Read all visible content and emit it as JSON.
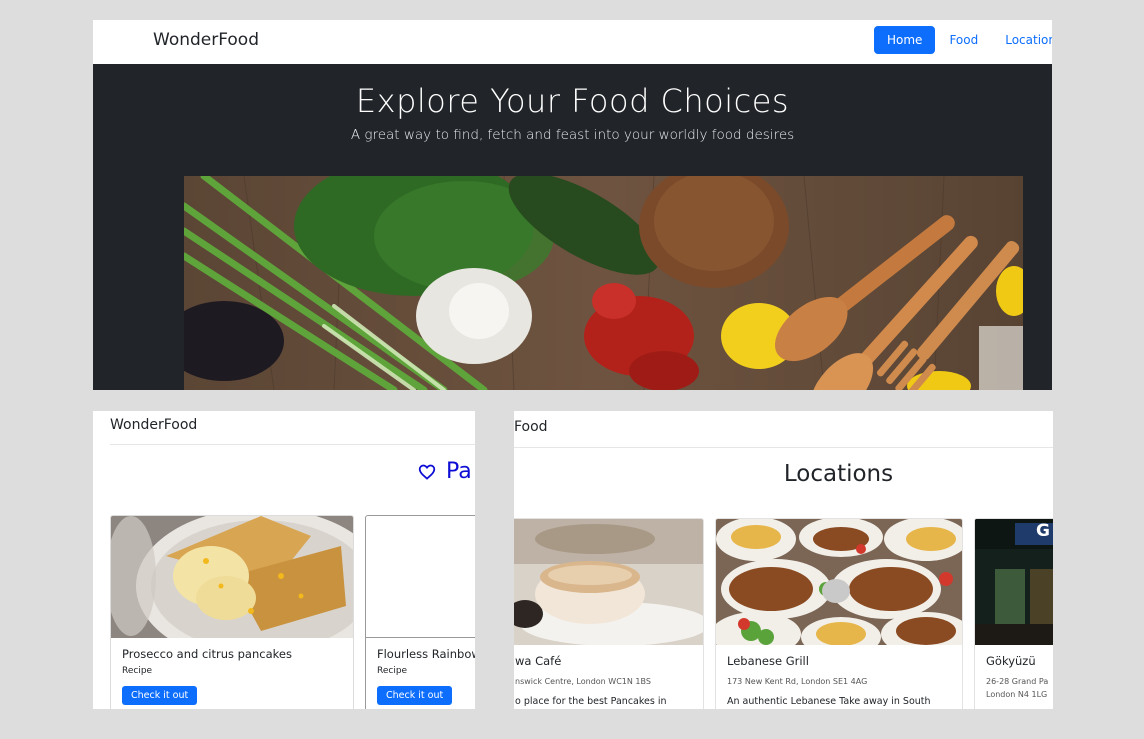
{
  "top": {
    "brand": "WonderFood",
    "nav": {
      "home": "Home",
      "food": "Food",
      "locations": "Locations"
    },
    "hero_title": "Explore Your Food Choices",
    "hero_subtitle": "A great way to find, fetch and feast into your worldly food desires"
  },
  "recipes": {
    "brand": "WonderFood",
    "favourites_label": "Pa",
    "cards": [
      {
        "title": "Prosecco and citrus pancakes",
        "type": "Recipe",
        "button": "Check it out"
      },
      {
        "title": "Flourless Rainbow",
        "type": "Recipe",
        "button": "Check it out"
      }
    ]
  },
  "locations": {
    "brand": "Food",
    "heading": "Locations",
    "cards": [
      {
        "name": "wa Café",
        "address": "nswick Centre, London WC1N 1BS",
        "description": "o place for the best Pancakes in"
      },
      {
        "name": "Lebanese Grill",
        "address": "173 New Kent Rd, London SE1 4AG",
        "description": "An authentic Lebanese Take away in South"
      },
      {
        "name": "Gökyüzü",
        "address_line1": "26-28 Grand Pa",
        "address_line2": "London N4 1LG",
        "sign": "G"
      }
    ]
  }
}
